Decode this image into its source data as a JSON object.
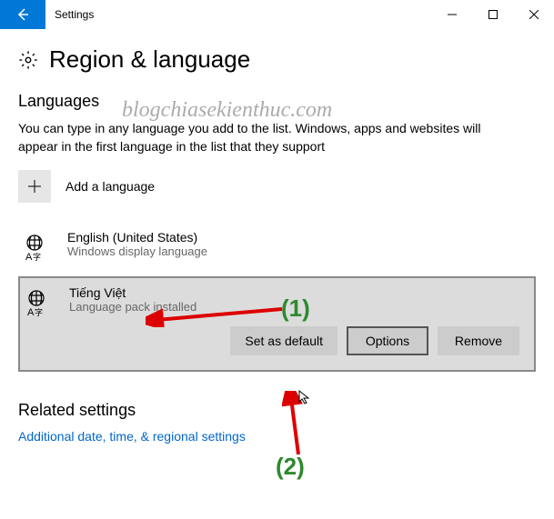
{
  "titlebar": {
    "title": "Settings"
  },
  "page": {
    "title": "Region & language"
  },
  "watermark": "blogchiasekienthuc.com",
  "languages": {
    "section_label": "Languages",
    "description": "You can type in any language you add to the list. Windows, apps and websites will appear in the first language in the list that they support",
    "add_label": "Add a language",
    "items": [
      {
        "name": "English (United States)",
        "sub": "Windows display language",
        "selected": false
      },
      {
        "name": "Tiếng Việt",
        "sub": "Language pack installed",
        "selected": true
      }
    ],
    "actions": {
      "set_default": "Set as default",
      "options": "Options",
      "remove": "Remove"
    }
  },
  "related": {
    "title": "Related settings",
    "link": "Additional date, time, & regional settings"
  },
  "annotations": {
    "label1": "(1)",
    "label2": "(2)"
  }
}
